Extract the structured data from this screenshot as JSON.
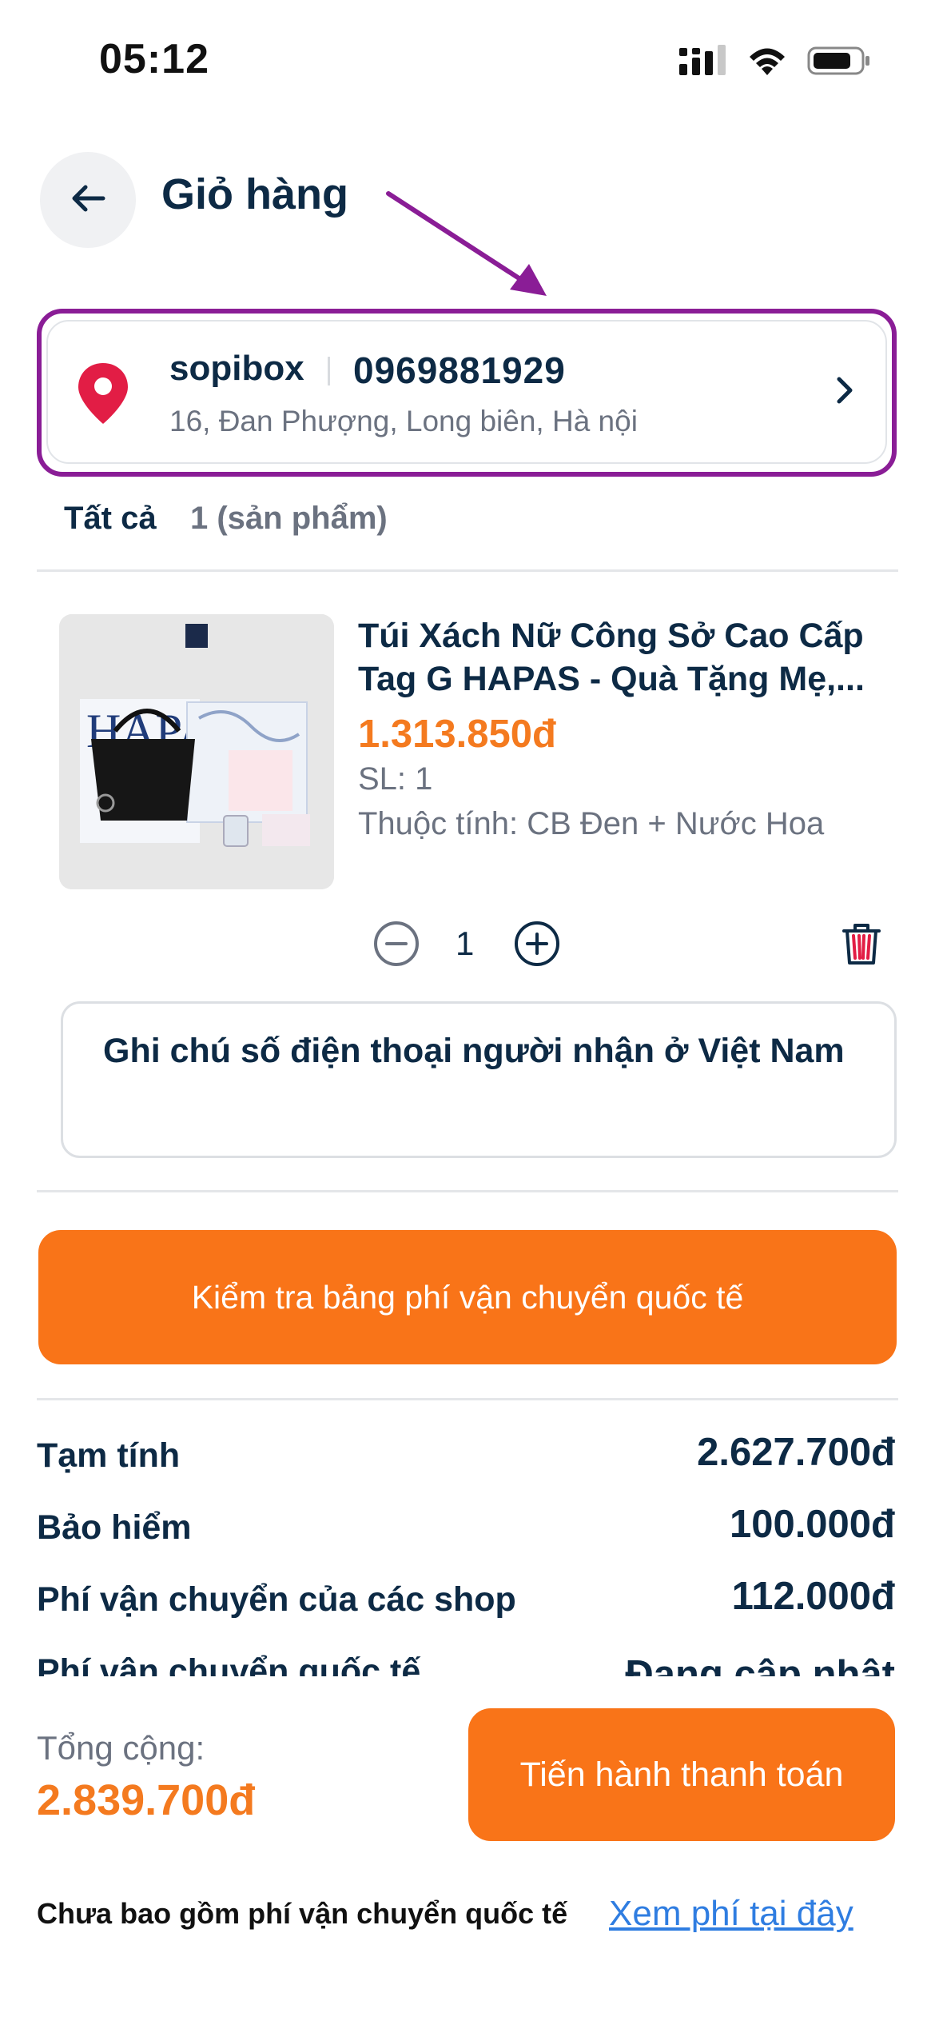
{
  "status_bar": {
    "time": "05:12"
  },
  "header": {
    "title": "Giỏ hàng"
  },
  "address": {
    "name": "sopibox",
    "phone": "0969881929",
    "line": "16, Đan Phượng, Long biên, Hà nội"
  },
  "cart_summary": {
    "all_label": "Tất cả",
    "count": "1 (sản phẩm)"
  },
  "product": {
    "title": "Túi Xách Nữ Công Sở Cao Cấp Tag G HAPAS - Quà Tặng Mẹ,...",
    "price": "1.313.850đ",
    "quantity_label": "SL: 1",
    "attributes": "Thuộc tính: CB Đen + Nước Hoa",
    "quantity": "1",
    "image_brand": "HAPAS"
  },
  "note": {
    "value": "Ghi chú số điện thoại người nhận ở Việt Nam"
  },
  "check_shipping_button": "Kiểm tra bảng phí vận chuyển quốc tế",
  "costs": [
    {
      "label": "Tạm tính",
      "value": "2.627.700đ"
    },
    {
      "label": "Bảo hiểm",
      "value": "100.000đ"
    },
    {
      "label": "Phí vận chuyển của các shop",
      "value": "112.000đ"
    },
    {
      "label": "Phí vận chuyển quốc tế",
      "value": "Đang cập nhật"
    }
  ],
  "checkout": {
    "total_label": "Tổng cộng:",
    "total_value": "2.839.700đ",
    "pay_button": "Tiến hành thanh toán"
  },
  "footer": {
    "note": "Chưa bao gồm phí vận chuyển quốc tế",
    "link": "Xem phí tại đây"
  },
  "colors": {
    "accent": "#f97418",
    "price": "#f47a1f",
    "text_dark": "#0d2a45",
    "annotation": "#8a1d96",
    "link": "#2f7de1"
  },
  "icons": [
    "signal-icon",
    "wifi-icon",
    "battery-icon",
    "back-arrow-icon",
    "location-pin-icon",
    "chevron-right-icon",
    "minus-circle-icon",
    "plus-circle-icon",
    "trash-icon"
  ]
}
